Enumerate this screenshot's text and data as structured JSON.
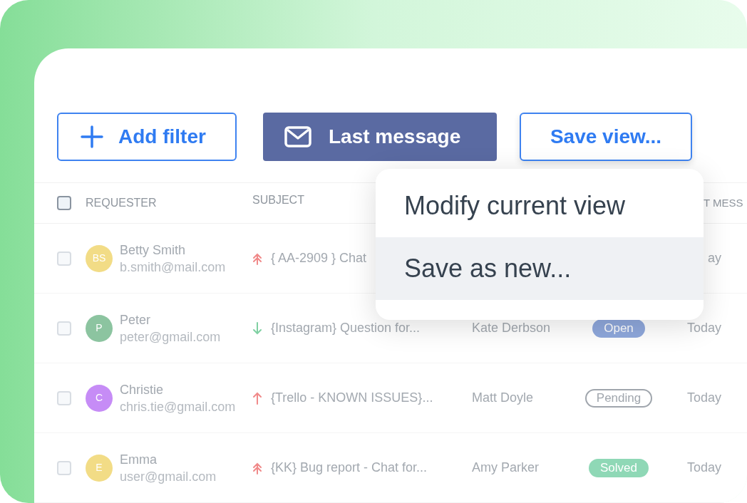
{
  "toolbar": [
    {
      "kind": "add",
      "label": "Add filter"
    },
    {
      "kind": "primary",
      "label": "Last message"
    },
    {
      "kind": "outline",
      "label": "Save view..."
    }
  ],
  "table": {
    "header_checkbox": {
      "checked": false
    },
    "columns": [
      {
        "label": "REQUESTER"
      },
      {
        "label": "SUBJECT"
      },
      {},
      {},
      {
        "label": "T MESS"
      }
    ],
    "rows": [
      {
        "checked": false,
        "avatar": {
          "initials": "BS",
          "color": "#f2dc86"
        },
        "name": "Betty Smith",
        "email": "b.smith@mail.com",
        "priority": {
          "kind": "urgent"
        },
        "subject": "{ AA-2909 } Chat",
        "date": "ay"
      },
      {
        "checked": false,
        "avatar": {
          "initials": "P",
          "color": "#8cc4a0"
        },
        "name": "Peter",
        "email": "peter@gmail.com",
        "priority": {
          "kind": "low"
        },
        "subject": "{Instagram} Question for...",
        "assignee": "Kate Derbson",
        "status": {
          "kind": "open",
          "label": "Open"
        },
        "date": "Today"
      },
      {
        "checked": false,
        "avatar": {
          "initials": "C",
          "color": "#c68cf6"
        },
        "name": "Christie",
        "email": "chris.tie@gmail.com",
        "priority": {
          "kind": "high"
        },
        "subject": "{Trello - KNOWN ISSUES}...",
        "assignee": "Matt Doyle",
        "status": {
          "kind": "pending",
          "label": "Pending"
        },
        "date": "Today"
      },
      {
        "checked": false,
        "avatar": {
          "initials": "E",
          "color": "#f2dc86"
        },
        "name": "Emma",
        "email": "user@gmail.com",
        "priority": {
          "kind": "urgent"
        },
        "subject": "{KK} Bug report - Chat for...",
        "assignee": "Amy Parker",
        "status": {
          "kind": "solved",
          "label": "Solved"
        },
        "date": "Today"
      }
    ]
  },
  "menu": {
    "items": [
      {
        "label": "Modify current view",
        "selected": false
      },
      {
        "label": "Save as new...",
        "selected": true
      }
    ]
  }
}
